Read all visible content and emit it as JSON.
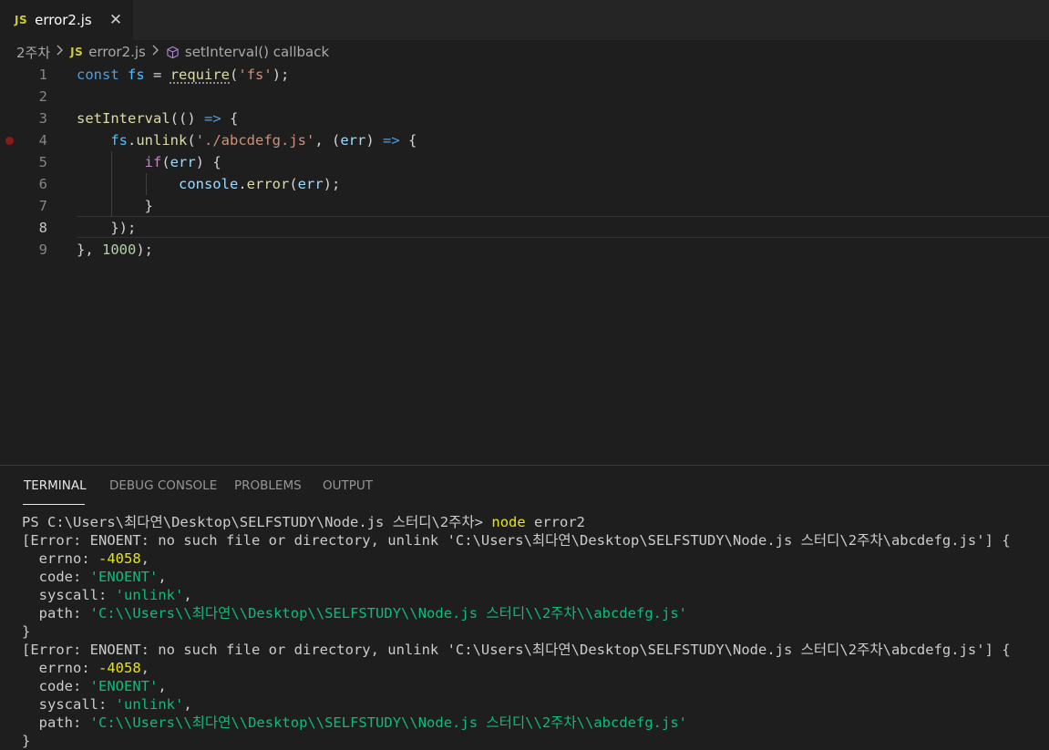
{
  "tab": {
    "icon": "JS",
    "label": "error2.js",
    "close": "✕"
  },
  "breadcrumb": {
    "folder": "2주차",
    "file_icon": "JS",
    "file": "error2.js",
    "symbol": "setInterval() callback"
  },
  "editor": {
    "line_numbers": [
      "1",
      "2",
      "3",
      "4",
      "5",
      "6",
      "7",
      "8",
      "9"
    ],
    "lines": [
      {
        "tokens": [
          {
            "t": "kw",
            "v": "const"
          },
          {
            "t": "punc",
            "v": " "
          },
          {
            "t": "var",
            "v": "fs"
          },
          {
            "t": "punc",
            "v": " = "
          },
          {
            "t": "fn",
            "v": "require",
            "squiggle": true
          },
          {
            "t": "punc",
            "v": "("
          },
          {
            "t": "str",
            "v": "'fs'"
          },
          {
            "t": "punc",
            "v": ");"
          }
        ]
      },
      {
        "tokens": []
      },
      {
        "tokens": [
          {
            "t": "fn",
            "v": "setInterval"
          },
          {
            "t": "punc",
            "v": "(() "
          },
          {
            "t": "kw",
            "v": "=>"
          },
          {
            "t": "punc",
            "v": " {"
          }
        ]
      },
      {
        "tokens": [
          {
            "t": "punc",
            "v": "    "
          },
          {
            "t": "var",
            "v": "fs"
          },
          {
            "t": "punc",
            "v": "."
          },
          {
            "t": "fn",
            "v": "unlink"
          },
          {
            "t": "punc",
            "v": "("
          },
          {
            "t": "str",
            "v": "'./abcdefg.js'"
          },
          {
            "t": "punc",
            "v": ", ("
          },
          {
            "t": "param",
            "v": "err"
          },
          {
            "t": "punc",
            "v": ") "
          },
          {
            "t": "kw",
            "v": "=>"
          },
          {
            "t": "punc",
            "v": " {"
          }
        ]
      },
      {
        "tokens": [
          {
            "t": "punc",
            "v": "        "
          },
          {
            "t": "ctrl",
            "v": "if"
          },
          {
            "t": "punc",
            "v": "("
          },
          {
            "t": "param",
            "v": "err"
          },
          {
            "t": "punc",
            "v": ") {"
          }
        ]
      },
      {
        "tokens": [
          {
            "t": "punc",
            "v": "            "
          },
          {
            "t": "param",
            "v": "console"
          },
          {
            "t": "punc",
            "v": "."
          },
          {
            "t": "fn",
            "v": "error"
          },
          {
            "t": "punc",
            "v": "("
          },
          {
            "t": "param",
            "v": "err"
          },
          {
            "t": "punc",
            "v": ");"
          }
        ]
      },
      {
        "tokens": [
          {
            "t": "punc",
            "v": "        }"
          }
        ]
      },
      {
        "tokens": [
          {
            "t": "punc",
            "v": "    });"
          }
        ]
      },
      {
        "tokens": [
          {
            "t": "punc",
            "v": "}, "
          },
          {
            "t": "num",
            "v": "1000"
          },
          {
            "t": "punc",
            "v": ");"
          }
        ]
      }
    ],
    "breakpoint_line": "4",
    "active_line": "8"
  },
  "panel": {
    "tabs": [
      "TERMINAL",
      "DEBUG CONSOLE",
      "PROBLEMS",
      "OUTPUT"
    ],
    "active_tab": "TERMINAL"
  },
  "terminal": {
    "lines": [
      [
        {
          "t": "plain",
          "v": "PS C:\\Users\\최다연\\Desktop\\SELFSTUDY\\Node.js 스터디\\2주차> "
        },
        {
          "t": "cmd",
          "v": "node"
        },
        {
          "t": "plain",
          "v": " error2"
        }
      ],
      [
        {
          "t": "plain",
          "v": "[Error: ENOENT: no such file or directory, unlink 'C:\\Users\\최다연\\Desktop\\SELFSTUDY\\Node.js 스터디\\2주차\\abcdefg.js'] {"
        }
      ],
      [
        {
          "t": "plain",
          "v": "  errno: "
        },
        {
          "t": "yellow",
          "v": "-4058"
        },
        {
          "t": "plain",
          "v": ","
        }
      ],
      [
        {
          "t": "plain",
          "v": "  code: "
        },
        {
          "t": "green",
          "v": "'ENOENT'"
        },
        {
          "t": "plain",
          "v": ","
        }
      ],
      [
        {
          "t": "plain",
          "v": "  syscall: "
        },
        {
          "t": "green",
          "v": "'unlink'"
        },
        {
          "t": "plain",
          "v": ","
        }
      ],
      [
        {
          "t": "plain",
          "v": "  path: "
        },
        {
          "t": "green",
          "v": "'C:\\\\Users\\\\최다연\\\\Desktop\\\\SELFSTUDY\\\\Node.js 스터디\\\\2주차\\\\abcdefg.js'"
        }
      ],
      [
        {
          "t": "plain",
          "v": "}"
        }
      ],
      [
        {
          "t": "plain",
          "v": "[Error: ENOENT: no such file or directory, unlink 'C:\\Users\\최다연\\Desktop\\SELFSTUDY\\Node.js 스터디\\2주차\\abcdefg.js'] {"
        }
      ],
      [
        {
          "t": "plain",
          "v": "  errno: "
        },
        {
          "t": "yellow",
          "v": "-4058"
        },
        {
          "t": "plain",
          "v": ","
        }
      ],
      [
        {
          "t": "plain",
          "v": "  code: "
        },
        {
          "t": "green",
          "v": "'ENOENT'"
        },
        {
          "t": "plain",
          "v": ","
        }
      ],
      [
        {
          "t": "plain",
          "v": "  syscall: "
        },
        {
          "t": "green",
          "v": "'unlink'"
        },
        {
          "t": "plain",
          "v": ","
        }
      ],
      [
        {
          "t": "plain",
          "v": "  path: "
        },
        {
          "t": "green",
          "v": "'C:\\\\Users\\\\최다연\\\\Desktop\\\\SELFSTUDY\\\\Node.js 스터디\\\\2주차\\\\abcdefg.js'"
        }
      ],
      [
        {
          "t": "plain",
          "v": "}"
        }
      ]
    ]
  },
  "colors": {
    "background": "#1e1e1e",
    "tabbar": "#252526",
    "keyword": "#569cd6",
    "function": "#dcdcaa",
    "string": "#ce9178",
    "terminal_green": "#0dbc79",
    "terminal_yellow": "#e5e510"
  },
  "icons": {
    "breadcrumb_symbol": "cube-icon",
    "separator": "chevron-right-icon",
    "breakpoint": "breakpoint-dot-icon"
  }
}
